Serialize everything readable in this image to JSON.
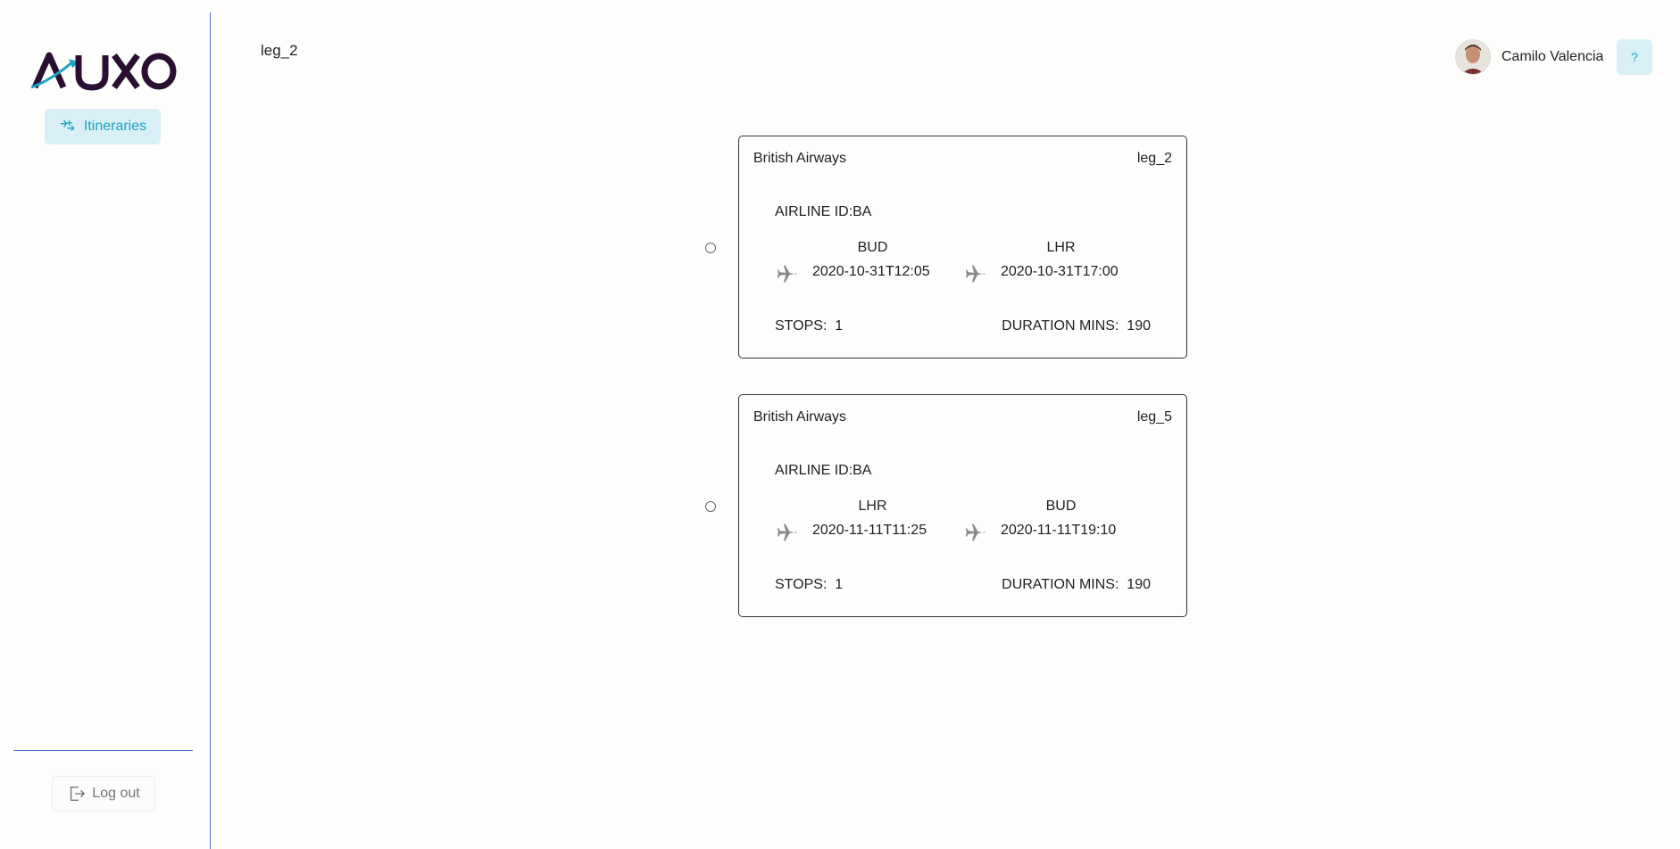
{
  "brand": {
    "logo_text": "AUXO"
  },
  "sidebar": {
    "nav_items": [
      {
        "label": "Itineraries",
        "icon": "flights-icon"
      }
    ],
    "logout_label": "Log out"
  },
  "header": {
    "page_title": "leg_2"
  },
  "user": {
    "name": "Camilo Valencia"
  },
  "help": {
    "label": "?"
  },
  "legs": [
    {
      "airline": "British Airways",
      "leg_id": "leg_2",
      "airline_id_label": "AIRLINE ID:BA",
      "departure": {
        "code": "BUD",
        "time": "2020-10-31T12:05"
      },
      "arrival": {
        "code": "LHR",
        "time": "2020-10-31T17:00"
      },
      "stops_label": "STOPS:",
      "stops": "1",
      "duration_label": "DURATION MINS:",
      "duration": "190"
    },
    {
      "airline": "British Airways",
      "leg_id": "leg_5",
      "airline_id_label": "AIRLINE ID:BA",
      "departure": {
        "code": "LHR",
        "time": "2020-11-11T11:25"
      },
      "arrival": {
        "code": "BUD",
        "time": "2020-11-11T19:10"
      },
      "stops_label": "STOPS:",
      "stops": "1",
      "duration_label": "DURATION MINS:",
      "duration": "190"
    }
  ],
  "colors": {
    "accent": "#1aa4c4",
    "accent_bg": "#d8f0f5",
    "divider": "#4a6fc9",
    "logo_dark": "#2b0f33"
  }
}
